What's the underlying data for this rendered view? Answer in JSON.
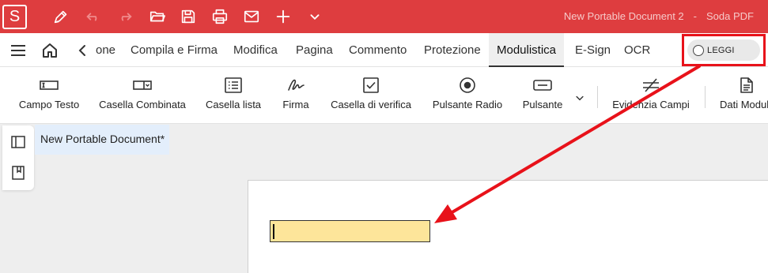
{
  "app": {
    "logo_letter": "S",
    "document_title": "New Portable Document 2",
    "separator": "-",
    "app_name": "Soda PDF"
  },
  "quick_access": [
    "sign-pen-icon",
    "undo-icon",
    "redo-icon",
    "open-folder-icon",
    "save-icon",
    "print-icon",
    "email-icon",
    "add-icon",
    "chevron-down-icon"
  ],
  "tabs": [
    {
      "label": "one"
    },
    {
      "label": "Compila e Firma"
    },
    {
      "label": "Modifica"
    },
    {
      "label": "Pagina"
    },
    {
      "label": "Commento"
    },
    {
      "label": "Protezione"
    },
    {
      "label": "Modulistica",
      "active": true
    },
    {
      "label": "E-Sign"
    },
    {
      "label": "OCR"
    }
  ],
  "read_mode": {
    "label": "LEGGI",
    "enabled": false
  },
  "ribbon": [
    {
      "label": "Campo Testo",
      "icon": "text-field-icon"
    },
    {
      "label": "Casella Combinata",
      "icon": "combo-box-icon"
    },
    {
      "label": "Casella lista",
      "icon": "list-box-icon"
    },
    {
      "label": "Firma",
      "icon": "signature-icon"
    },
    {
      "label": "Casella di verifica",
      "icon": "checkbox-icon"
    },
    {
      "label": "Pulsante Radio",
      "icon": "radio-button-icon"
    },
    {
      "label": "Pulsante",
      "icon": "push-button-icon"
    },
    {
      "label": "Evidenzia Campi",
      "icon": "highlight-fields-icon"
    },
    {
      "label": "Dati Modul",
      "icon": "form-data-icon"
    }
  ],
  "document_tab": {
    "label": "New Portable Document*"
  },
  "colors": {
    "titlebar": "#de3d3f",
    "annotation": "#e8121a",
    "form_field_fill": "#fde59a",
    "doc_tab_bg": "#e3eefb"
  }
}
